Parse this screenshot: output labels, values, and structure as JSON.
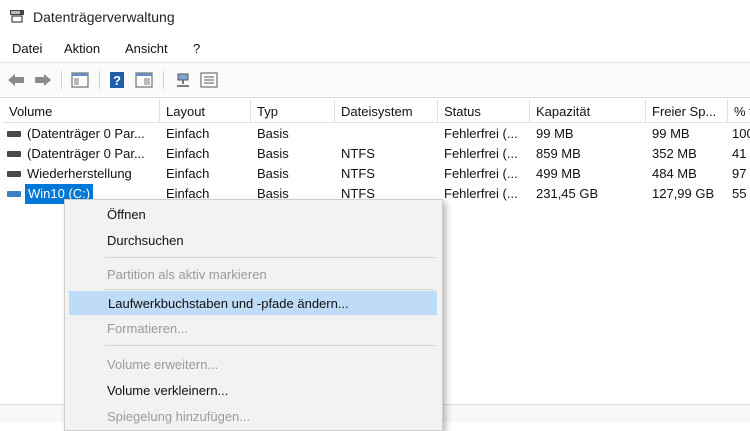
{
  "window": {
    "title": "Datenträgerverwaltung"
  },
  "menubar": [
    "Datei",
    "Aktion",
    "Ansicht",
    "?"
  ],
  "toolbar": {
    "icons": [
      "back-arrow-icon",
      "forward-arrow-icon",
      "console-tree-icon",
      "help-icon",
      "properties-icon",
      "connect-icon",
      "list-view-icon"
    ]
  },
  "table": {
    "columns": [
      "Volume",
      "Layout",
      "Typ",
      "Dateisystem",
      "Status",
      "Kapazität",
      "Freier Sp...",
      "% f"
    ],
    "rows": [
      [
        "(Datenträger 0 Par...",
        "Einfach",
        "Basis",
        "",
        "Fehlerfrei (...",
        "99 MB",
        "99 MB",
        "100"
      ],
      [
        "(Datenträger 0 Par...",
        "Einfach",
        "Basis",
        "NTFS",
        "Fehlerfrei (...",
        "859 MB",
        "352 MB",
        "41"
      ],
      [
        "Wiederherstellung",
        "Einfach",
        "Basis",
        "NTFS",
        "Fehlerfrei (...",
        "499 MB",
        "484 MB",
        "97"
      ],
      [
        "Win10 (C:)",
        "Einfach",
        "Basis",
        "NTFS",
        "Fehlerfrei (...",
        "231,45 GB",
        "127,99 GB",
        "55"
      ]
    ]
  },
  "context_menu": {
    "items": [
      {
        "label": "Öffnen",
        "enabled": true
      },
      {
        "label": "Durchsuchen",
        "enabled": true
      },
      {
        "label": "Partition als aktiv markieren",
        "enabled": false
      },
      {
        "label": "Laufwerkbuchstaben und -pfade ändern...",
        "enabled": true,
        "highlighted": true
      },
      {
        "label": "Formatieren...",
        "enabled": false
      },
      {
        "label": "Volume erweitern...",
        "enabled": false
      },
      {
        "label": "Volume verkleinern...",
        "enabled": true
      },
      {
        "label": "Spiegelung hinzufügen...",
        "enabled": false
      }
    ]
  },
  "colors": {
    "selection": "#0078d7",
    "menu_highlight": "#bfdcf6",
    "disabled_text": "#9a9a9a"
  }
}
